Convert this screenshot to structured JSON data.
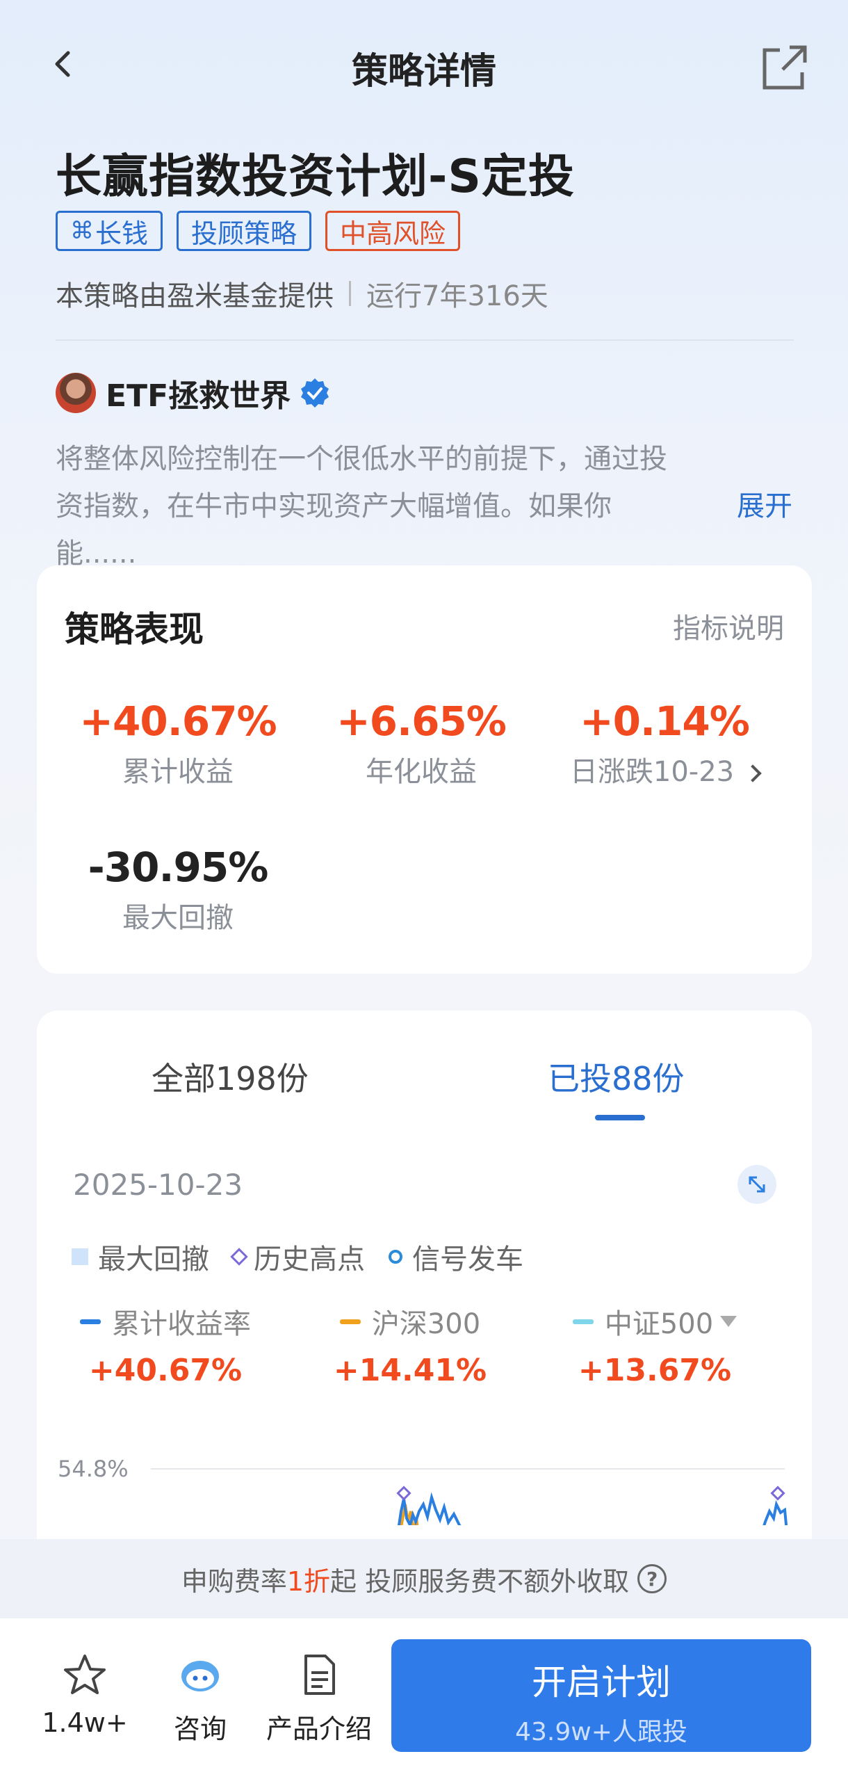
{
  "nav": {
    "title": "策略详情"
  },
  "strategy": {
    "title": "长赢指数投资计划-S定投",
    "tags": [
      "长钱",
      "投顾策略",
      "中高风险"
    ],
    "provider": "本策略由盈米基金提供",
    "running": "运行7年316天"
  },
  "author": {
    "name": "ETF拯救世界",
    "description": "将整体风险控制在一个很低水平的前提下，通过投资指数，在牛市中实现资产大幅增值。如果你能......",
    "expand_label": "展开"
  },
  "performance": {
    "title": "策略表现",
    "help_label": "指标说明",
    "metrics": [
      {
        "value": "+40.67%",
        "label": "累计收益"
      },
      {
        "value": "+6.65%",
        "label": "年化收益"
      },
      {
        "value": "+0.14%",
        "label": "日涨跌10-23"
      },
      {
        "value": "-30.95%",
        "label": "最大回撤"
      }
    ]
  },
  "returns": {
    "tabs": [
      {
        "label": "全部198份"
      },
      {
        "label": "已投88份"
      }
    ],
    "date": "2025-10-23",
    "legend": [
      "最大回撤",
      "历史高点",
      "信号发车"
    ],
    "series": [
      {
        "name": "累计收益率",
        "value": "+40.67%",
        "color": "#2a7fe0"
      },
      {
        "name": "沪深300",
        "value": "+14.41%",
        "color": "#f0a11e"
      },
      {
        "name": "中证500",
        "value": "+13.67%",
        "color": "#7fd6ea"
      }
    ],
    "y_top_label": "54.8%"
  },
  "chart_data": {
    "type": "line",
    "ylim_top_label": "54.8%",
    "series": [
      {
        "name": "累计收益率",
        "color": "#2a7fe0"
      },
      {
        "name": "沪深300",
        "color": "#f0a11e"
      },
      {
        "name": "中证500",
        "color": "#7fd6ea"
      }
    ]
  },
  "notice": {
    "prefix": "申购费率",
    "highlight": "1折",
    "suffix": "起 投顾服务费不额外收取"
  },
  "bottom_bar": {
    "favorite_count": "1.4w+",
    "consult_label": "咨询",
    "intro_label": "产品介绍",
    "cta_label": "开启计划",
    "cta_sub": "43.9w+人跟投"
  },
  "colors": {
    "accent": "#2f7bea",
    "positive": "#f04a1e",
    "risk": "#e0512a"
  }
}
